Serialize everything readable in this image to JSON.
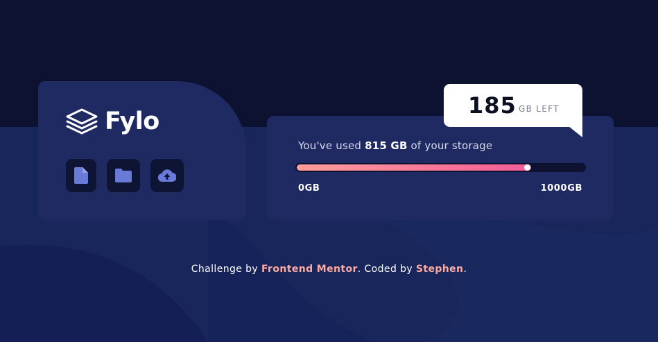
{
  "colors": {
    "background_top": "#0c1230",
    "background_bottom": "#18265b",
    "card": "#1f2a62",
    "icon_tile": "#0e1433",
    "icon_fill": "#6a7ad8",
    "gradient_start": "#fc9e98",
    "gradient_end": "#f35c97",
    "link": "#fcaaa2"
  },
  "logo": {
    "icon": "stacked-layers-icon",
    "text": "Fylo"
  },
  "toolbar": [
    {
      "icon": "document-icon"
    },
    {
      "icon": "folder-icon"
    },
    {
      "icon": "cloud-upload-icon"
    }
  ],
  "storage": {
    "usage_prefix": "You've used",
    "usage_amount": "815 GB",
    "usage_suffix": "of your storage",
    "used_fraction": 0.815,
    "min_label": "0GB",
    "max_label": "1000GB"
  },
  "callout": {
    "remaining": "185",
    "unit": "GB LEFT"
  },
  "footer": {
    "prefix": "Challenge by",
    "challenge_link": "Frontend Mentor",
    "middle": ". Coded by",
    "author_link": "Stephen",
    "suffix": "."
  }
}
